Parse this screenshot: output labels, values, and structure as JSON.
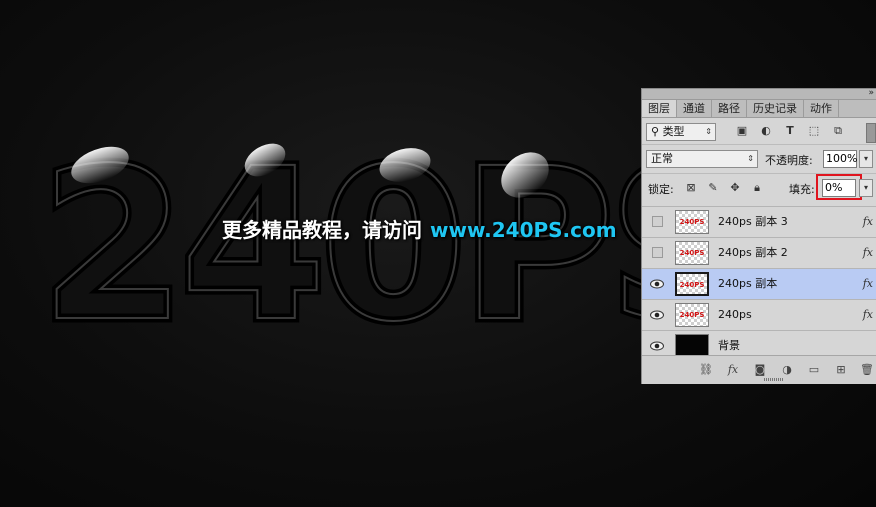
{
  "canvas": {
    "art_text": "240PS",
    "watermark_text": "更多精品教程，请访问",
    "watermark_url": "www.240PS.com",
    "watermark_url_color": "#1fc6f2",
    "background_color": "#0c0c0c"
  },
  "panel": {
    "tabs": [
      "图层",
      "通道",
      "路径",
      "历史记录",
      "动作"
    ],
    "active_tab": "图层",
    "filter": {
      "kind_label": "类型",
      "search_icon": "search-icon"
    },
    "blend_mode": "正常",
    "opacity_label": "不透明度:",
    "opacity_value": "100%",
    "lock_label": "锁定:",
    "fill_label": "填充:",
    "fill_value": "0%",
    "layers": [
      {
        "name": "240ps 副本 3",
        "thumb_text": "240PS",
        "visible": false,
        "selected": false,
        "fx": "fx"
      },
      {
        "name": "240ps 副本 2",
        "thumb_text": "240PS",
        "visible": false,
        "selected": false,
        "fx": "fx"
      },
      {
        "name": "240ps 副本",
        "thumb_text": "240PS",
        "visible": true,
        "selected": true,
        "fx": "fx"
      },
      {
        "name": "240ps",
        "thumb_text": "240PS",
        "visible": true,
        "selected": false,
        "fx": "fx"
      },
      {
        "name": "背景",
        "thumb_text": "",
        "visible": true,
        "selected": false,
        "fx": ""
      }
    ],
    "highlight_color": "#e0141e",
    "selected_layer_color": "#b9cbf3"
  }
}
